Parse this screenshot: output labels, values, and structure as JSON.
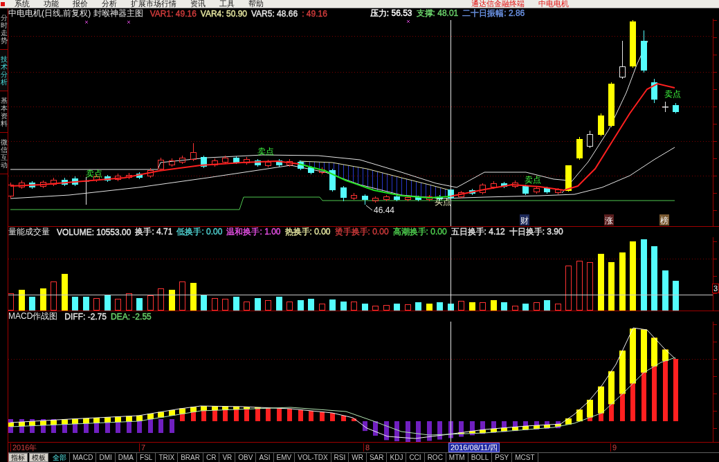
{
  "menu_bar": {
    "items": [
      "系统",
      "功能",
      "报价",
      "分析",
      "扩展市场行情",
      "资讯",
      "工具",
      "帮助"
    ],
    "app_title": "通达信金融终端",
    "stock_name": "中电电机"
  },
  "side_tabs": [
    {
      "label": "分时走势",
      "selected": false
    },
    {
      "label": "技术分析",
      "selected": true
    },
    {
      "label": "基本资料",
      "selected": false
    },
    {
      "label": "微信互动",
      "selected": false
    }
  ],
  "price_panel": {
    "title": "中电电机(日线,前复权) 封喉神器主图",
    "indicators": [
      {
        "text": "VAR1: 49.16",
        "color": "#d23c3c"
      },
      {
        "text": "VAR4: 50.90",
        "color": "#e6e6a0"
      },
      {
        "text": "VAR5: 48.66",
        "color": "#e6e6e6"
      },
      {
        "text": ": 49.16",
        "color": "#d23c3c"
      }
    ],
    "levels": [
      {
        "text": "压力: 56.53",
        "color": "#ffffff"
      },
      {
        "text": "支撑: 48.01",
        "color": "#6cd46c"
      },
      {
        "text": "二十日振幅: 2.86",
        "color": "#6c94e6"
      }
    ],
    "signals": [
      {
        "kind": "sell",
        "text": "卖点"
      },
      {
        "kind": "sell",
        "text": "卖点"
      },
      {
        "kind": "buy",
        "text": "买点"
      },
      {
        "kind": "sell",
        "text": "卖点"
      },
      {
        "kind": "sell",
        "text": "卖点"
      }
    ],
    "low_label": "46.44",
    "event_markers": [
      {
        "text": "财",
        "color": "#1e2a5a"
      },
      {
        "text": "涨",
        "color": "#5a1e1e"
      },
      {
        "text": "榜",
        "color": "#7a5a32"
      }
    ]
  },
  "volume_panel": {
    "title": "量能成交量",
    "indicators": [
      {
        "text": "VOLUME: 10553.00",
        "color": "#e6e6e6"
      },
      {
        "text": "换手: 4.71",
        "color": "#e6e6e6"
      },
      {
        "text": "低换手: 0.00",
        "color": "#50d2d2"
      },
      {
        "text": "温和换手: 1.00",
        "color": "#e650e6"
      },
      {
        "text": "热换手: 0.00",
        "color": "#e6e6a0"
      },
      {
        "text": "烫手换手: 0.00",
        "color": "#d23c3c"
      },
      {
        "text": "高潮换手: 0.00",
        "color": "#50d250"
      },
      {
        "text": "五日换手: 4.12",
        "color": "#e6e6e6"
      },
      {
        "text": "十日换手: 3.90",
        "color": "#e6e6e6"
      }
    ],
    "axis_label": "3"
  },
  "macd_panel": {
    "title": "MACD作战图",
    "indicators": [
      {
        "text": "DIFF: -2.75",
        "color": "#e6e6e6"
      },
      {
        "text": "DEA: -2.55",
        "color": "#6cd46c"
      }
    ]
  },
  "time_axis": [
    {
      "kind": "month",
      "text": "2016年"
    },
    {
      "kind": "month",
      "text": "7"
    },
    {
      "kind": "month",
      "text": "8"
    },
    {
      "kind": "cursor",
      "text": "2016/08/11/四"
    },
    {
      "kind": "month",
      "text": "9"
    }
  ],
  "bottom_bar": {
    "buttons": [
      "指标",
      "模板"
    ],
    "tabs": [
      {
        "label": "全部",
        "selected": true
      },
      {
        "label": "MACD",
        "selected": false
      },
      {
        "label": "DMI",
        "selected": false
      },
      {
        "label": "DMA",
        "selected": false
      },
      {
        "label": "FSL",
        "selected": false
      },
      {
        "label": "TRIX",
        "selected": false
      },
      {
        "label": "BRAR",
        "selected": false
      },
      {
        "label": "CR",
        "selected": false
      },
      {
        "label": "VR",
        "selected": false
      },
      {
        "label": "OBV",
        "selected": false
      },
      {
        "label": "ASI",
        "selected": false
      },
      {
        "label": "EMV",
        "selected": false
      },
      {
        "label": "VOL-TDX",
        "selected": false
      },
      {
        "label": "RSI",
        "selected": false
      },
      {
        "label": "WR",
        "selected": false
      },
      {
        "label": "SAR",
        "selected": false
      },
      {
        "label": "KDJ",
        "selected": false
      },
      {
        "label": "CCI",
        "selected": false
      },
      {
        "label": "ROC",
        "selected": false
      },
      {
        "label": "MTM",
        "selected": false
      },
      {
        "label": "BOLL",
        "selected": false
      },
      {
        "label": "PSY",
        "selected": false
      },
      {
        "label": "MCST",
        "selected": false
      }
    ]
  }
}
